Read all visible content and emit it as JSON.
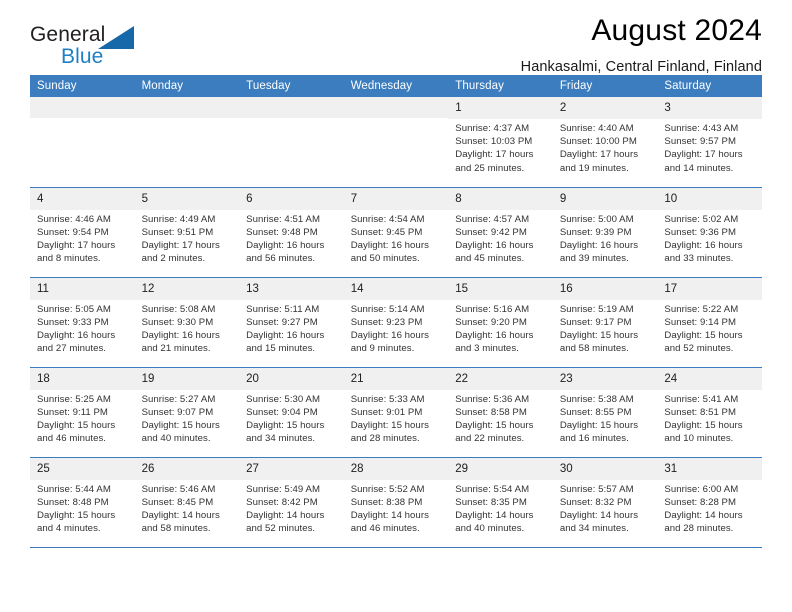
{
  "brand": {
    "name_top": "General",
    "name_bottom": "Blue",
    "triangle_color": "#1668a8",
    "accent_color": "#1f7fc4"
  },
  "header": {
    "title": "August 2024",
    "location": "Hankasalmi, Central Finland, Finland"
  },
  "calendar": {
    "header_bg": "#3b7dbe",
    "daynum_bg": "#f0f0f0",
    "weekdays": [
      "Sunday",
      "Monday",
      "Tuesday",
      "Wednesday",
      "Thursday",
      "Friday",
      "Saturday"
    ],
    "weeks": [
      [
        {
          "empty": true
        },
        {
          "empty": true
        },
        {
          "empty": true
        },
        {
          "empty": true
        },
        {
          "day": "1",
          "sunrise": "Sunrise: 4:37 AM",
          "sunset": "Sunset: 10:03 PM",
          "daylight1": "Daylight: 17 hours",
          "daylight2": "and 25 minutes."
        },
        {
          "day": "2",
          "sunrise": "Sunrise: 4:40 AM",
          "sunset": "Sunset: 10:00 PM",
          "daylight1": "Daylight: 17 hours",
          "daylight2": "and 19 minutes."
        },
        {
          "day": "3",
          "sunrise": "Sunrise: 4:43 AM",
          "sunset": "Sunset: 9:57 PM",
          "daylight1": "Daylight: 17 hours",
          "daylight2": "and 14 minutes."
        }
      ],
      [
        {
          "day": "4",
          "sunrise": "Sunrise: 4:46 AM",
          "sunset": "Sunset: 9:54 PM",
          "daylight1": "Daylight: 17 hours",
          "daylight2": "and 8 minutes."
        },
        {
          "day": "5",
          "sunrise": "Sunrise: 4:49 AM",
          "sunset": "Sunset: 9:51 PM",
          "daylight1": "Daylight: 17 hours",
          "daylight2": "and 2 minutes."
        },
        {
          "day": "6",
          "sunrise": "Sunrise: 4:51 AM",
          "sunset": "Sunset: 9:48 PM",
          "daylight1": "Daylight: 16 hours",
          "daylight2": "and 56 minutes."
        },
        {
          "day": "7",
          "sunrise": "Sunrise: 4:54 AM",
          "sunset": "Sunset: 9:45 PM",
          "daylight1": "Daylight: 16 hours",
          "daylight2": "and 50 minutes."
        },
        {
          "day": "8",
          "sunrise": "Sunrise: 4:57 AM",
          "sunset": "Sunset: 9:42 PM",
          "daylight1": "Daylight: 16 hours",
          "daylight2": "and 45 minutes."
        },
        {
          "day": "9",
          "sunrise": "Sunrise: 5:00 AM",
          "sunset": "Sunset: 9:39 PM",
          "daylight1": "Daylight: 16 hours",
          "daylight2": "and 39 minutes."
        },
        {
          "day": "10",
          "sunrise": "Sunrise: 5:02 AM",
          "sunset": "Sunset: 9:36 PM",
          "daylight1": "Daylight: 16 hours",
          "daylight2": "and 33 minutes."
        }
      ],
      [
        {
          "day": "11",
          "sunrise": "Sunrise: 5:05 AM",
          "sunset": "Sunset: 9:33 PM",
          "daylight1": "Daylight: 16 hours",
          "daylight2": "and 27 minutes."
        },
        {
          "day": "12",
          "sunrise": "Sunrise: 5:08 AM",
          "sunset": "Sunset: 9:30 PM",
          "daylight1": "Daylight: 16 hours",
          "daylight2": "and 21 minutes."
        },
        {
          "day": "13",
          "sunrise": "Sunrise: 5:11 AM",
          "sunset": "Sunset: 9:27 PM",
          "daylight1": "Daylight: 16 hours",
          "daylight2": "and 15 minutes."
        },
        {
          "day": "14",
          "sunrise": "Sunrise: 5:14 AM",
          "sunset": "Sunset: 9:23 PM",
          "daylight1": "Daylight: 16 hours",
          "daylight2": "and 9 minutes."
        },
        {
          "day": "15",
          "sunrise": "Sunrise: 5:16 AM",
          "sunset": "Sunset: 9:20 PM",
          "daylight1": "Daylight: 16 hours",
          "daylight2": "and 3 minutes."
        },
        {
          "day": "16",
          "sunrise": "Sunrise: 5:19 AM",
          "sunset": "Sunset: 9:17 PM",
          "daylight1": "Daylight: 15 hours",
          "daylight2": "and 58 minutes."
        },
        {
          "day": "17",
          "sunrise": "Sunrise: 5:22 AM",
          "sunset": "Sunset: 9:14 PM",
          "daylight1": "Daylight: 15 hours",
          "daylight2": "and 52 minutes."
        }
      ],
      [
        {
          "day": "18",
          "sunrise": "Sunrise: 5:25 AM",
          "sunset": "Sunset: 9:11 PM",
          "daylight1": "Daylight: 15 hours",
          "daylight2": "and 46 minutes."
        },
        {
          "day": "19",
          "sunrise": "Sunrise: 5:27 AM",
          "sunset": "Sunset: 9:07 PM",
          "daylight1": "Daylight: 15 hours",
          "daylight2": "and 40 minutes."
        },
        {
          "day": "20",
          "sunrise": "Sunrise: 5:30 AM",
          "sunset": "Sunset: 9:04 PM",
          "daylight1": "Daylight: 15 hours",
          "daylight2": "and 34 minutes."
        },
        {
          "day": "21",
          "sunrise": "Sunrise: 5:33 AM",
          "sunset": "Sunset: 9:01 PM",
          "daylight1": "Daylight: 15 hours",
          "daylight2": "and 28 minutes."
        },
        {
          "day": "22",
          "sunrise": "Sunrise: 5:36 AM",
          "sunset": "Sunset: 8:58 PM",
          "daylight1": "Daylight: 15 hours",
          "daylight2": "and 22 minutes."
        },
        {
          "day": "23",
          "sunrise": "Sunrise: 5:38 AM",
          "sunset": "Sunset: 8:55 PM",
          "daylight1": "Daylight: 15 hours",
          "daylight2": "and 16 minutes."
        },
        {
          "day": "24",
          "sunrise": "Sunrise: 5:41 AM",
          "sunset": "Sunset: 8:51 PM",
          "daylight1": "Daylight: 15 hours",
          "daylight2": "and 10 minutes."
        }
      ],
      [
        {
          "day": "25",
          "sunrise": "Sunrise: 5:44 AM",
          "sunset": "Sunset: 8:48 PM",
          "daylight1": "Daylight: 15 hours",
          "daylight2": "and 4 minutes."
        },
        {
          "day": "26",
          "sunrise": "Sunrise: 5:46 AM",
          "sunset": "Sunset: 8:45 PM",
          "daylight1": "Daylight: 14 hours",
          "daylight2": "and 58 minutes."
        },
        {
          "day": "27",
          "sunrise": "Sunrise: 5:49 AM",
          "sunset": "Sunset: 8:42 PM",
          "daylight1": "Daylight: 14 hours",
          "daylight2": "and 52 minutes."
        },
        {
          "day": "28",
          "sunrise": "Sunrise: 5:52 AM",
          "sunset": "Sunset: 8:38 PM",
          "daylight1": "Daylight: 14 hours",
          "daylight2": "and 46 minutes."
        },
        {
          "day": "29",
          "sunrise": "Sunrise: 5:54 AM",
          "sunset": "Sunset: 8:35 PM",
          "daylight1": "Daylight: 14 hours",
          "daylight2": "and 40 minutes."
        },
        {
          "day": "30",
          "sunrise": "Sunrise: 5:57 AM",
          "sunset": "Sunset: 8:32 PM",
          "daylight1": "Daylight: 14 hours",
          "daylight2": "and 34 minutes."
        },
        {
          "day": "31",
          "sunrise": "Sunrise: 6:00 AM",
          "sunset": "Sunset: 8:28 PM",
          "daylight1": "Daylight: 14 hours",
          "daylight2": "and 28 minutes."
        }
      ]
    ]
  }
}
